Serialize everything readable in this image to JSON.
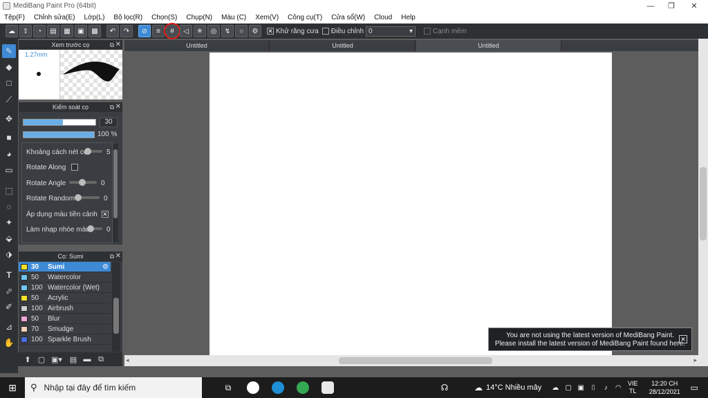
{
  "titlebar": {
    "title": "MediBang Paint Pro (64bit)",
    "minimize": "—",
    "restore": "❐",
    "close": "✕"
  },
  "menu": [
    "Tệp(F)",
    "Chỉnh sửa(E)",
    "Lớp(L)",
    "Bộ lọc(R)",
    "Chọn(S)",
    "Chụp(N)",
    "Màu (C)",
    "Xem(V)",
    "Công cụ(T)",
    "Cửa sổ(W)",
    "Cloud",
    "Help"
  ],
  "toolbar": {
    "antialias_label": "Khử răng cưa",
    "antialias_checked": "✕",
    "adjust_label": "Điều chỉnh",
    "adjust_value": "0",
    "edge_label": "Cạnh mềm",
    "icons": {
      "cloud": "☁",
      "undo": "↶",
      "redo": "↷"
    }
  },
  "preview": {
    "title": "Xem trước cọ",
    "size": "1.27mm"
  },
  "brush_control": {
    "title": "Kiểm soát cọ",
    "width_value": "30",
    "opacity_value": "100 %",
    "width_fraction": 0.55,
    "opacity_fraction": 1.0,
    "params": [
      {
        "label": "Khoảng cách nét cọ",
        "value": "5",
        "type": "slider",
        "level": 0.0
      },
      {
        "label": "Rotate Along",
        "value": "",
        "type": "checkbox",
        "checked": ""
      },
      {
        "label": "Rotate Angle",
        "value": "0",
        "type": "slider",
        "level": 0.45
      },
      {
        "label": "Rotate Random",
        "value": "0",
        "type": "slider",
        "level": 0.0
      },
      {
        "label": "Áp dụng màu tiền cảnh",
        "value": "",
        "type": "checkbox",
        "checked": "✕"
      },
      {
        "label": "Làm nhạp nhòe màu",
        "value": "0",
        "type": "slider",
        "level": 0.0
      }
    ]
  },
  "brush_list": {
    "title": "Cọ: Sumi",
    "items": [
      {
        "size": "30",
        "name": "Sumi",
        "color": "#f5e12a",
        "selected": true
      },
      {
        "size": "50",
        "name": "Watercolor",
        "color": "#6fc7f0"
      },
      {
        "size": "100",
        "name": "Watercolor (Wet)",
        "color": "#6fc7f0"
      },
      {
        "size": "50",
        "name": "Acrylic",
        "color": "#f5e12a"
      },
      {
        "size": "100",
        "name": "Airbrush",
        "color": "#cfcfcf"
      },
      {
        "size": "50",
        "name": "Blur",
        "color": "#f0a8d8"
      },
      {
        "size": "70",
        "name": "Smudge",
        "color": "#f7d0b8"
      },
      {
        "size": "100",
        "name": "Sparkle Brush",
        "color": "#4a6de0"
      }
    ]
  },
  "tabs": [
    "Untitled",
    "Untitled",
    "Untitled"
  ],
  "toast": {
    "line1": "You are not using the latest version of MediBang Paint.",
    "line2": "Please install the latest version of MediBang Paint found here.",
    "close": "✕"
  },
  "taskbar": {
    "search_placeholder": "Nhập tại đây để tìm kiếm",
    "weather": "14°C  Nhiều mây",
    "lang1": "VIE",
    "lang2": "TL",
    "time": "12:20 CH",
    "date": "28/12/2021"
  }
}
